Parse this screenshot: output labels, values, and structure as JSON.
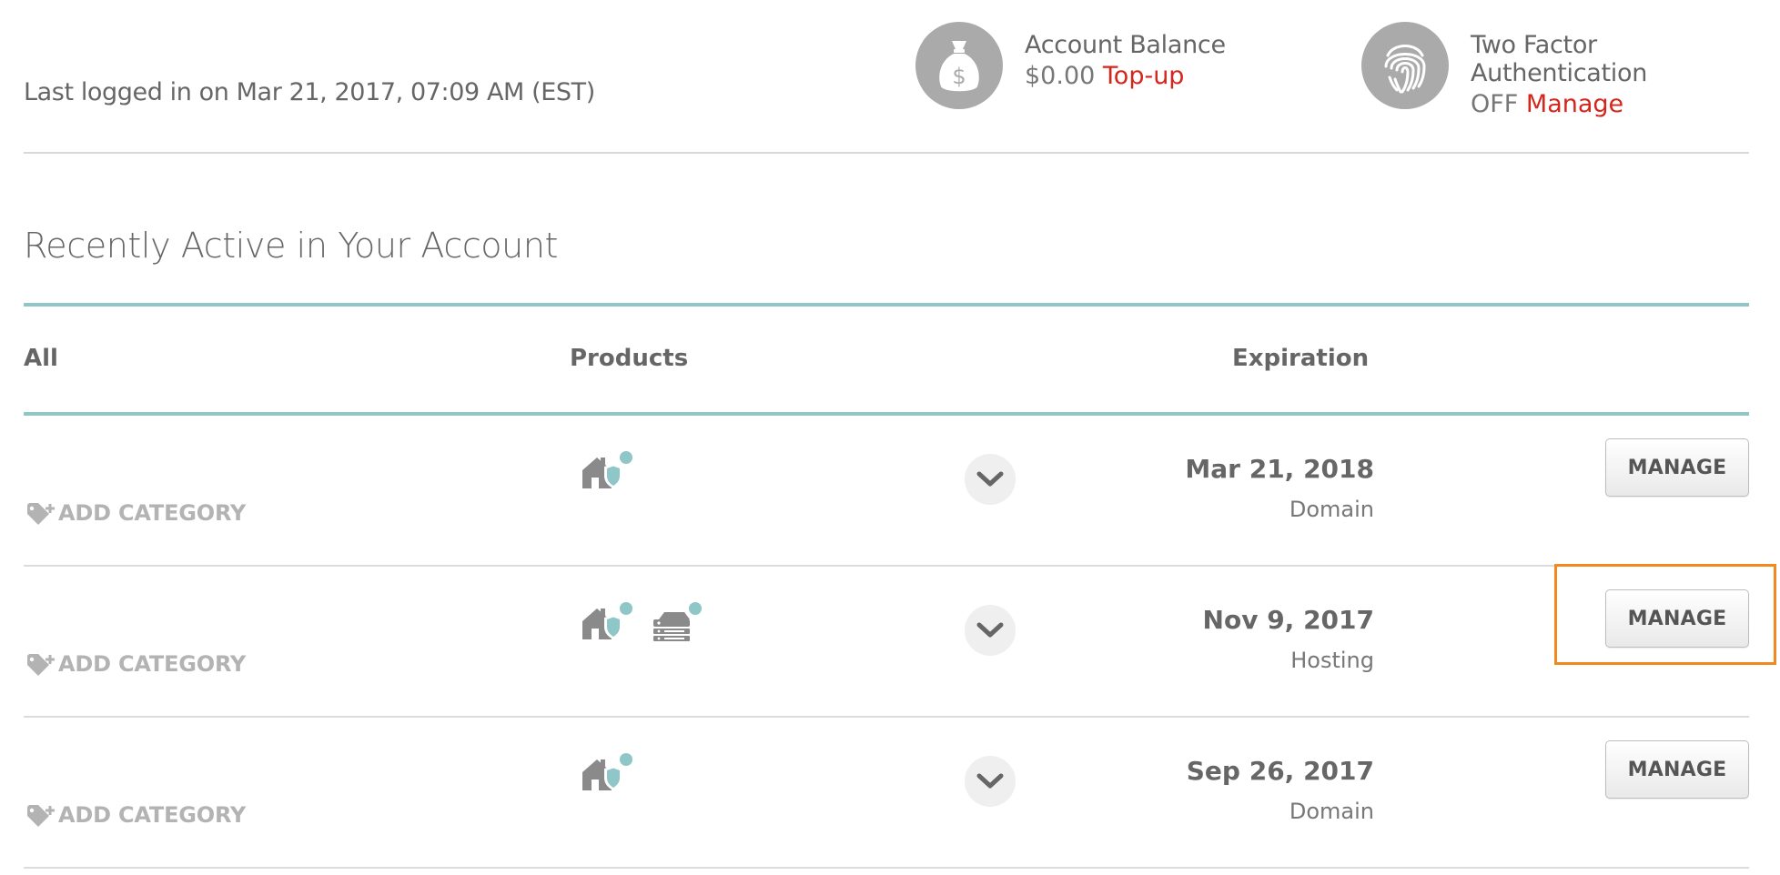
{
  "header": {
    "last_login": "Last logged in on Mar 21, 2017, 07:09 AM (EST)",
    "balance": {
      "icon": "money-bag-icon",
      "title": "Account Balance",
      "value": "$0.00",
      "link": "Top-up"
    },
    "two_factor": {
      "icon": "fingerprint-icon",
      "title_line1": "Two Factor",
      "title_line2": "Authentication",
      "status": "OFF",
      "link": "Manage"
    }
  },
  "section": {
    "title": "Recently Active in Your Account",
    "columns": {
      "all": "All",
      "products": "Products",
      "expiration": "Expiration"
    }
  },
  "rows": [
    {
      "add_category": "ADD CATEGORY",
      "products": [
        "domain-icon"
      ],
      "date": "Mar 21, 2018",
      "type": "Domain",
      "manage": "MANAGE"
    },
    {
      "add_category": "ADD CATEGORY",
      "products": [
        "domain-icon",
        "hosting-server-icon"
      ],
      "date": "Nov 9, 2017",
      "type": "Hosting",
      "manage": "MANAGE",
      "highlighted": true
    },
    {
      "add_category": "ADD CATEGORY",
      "products": [
        "domain-icon"
      ],
      "date": "Sep 26, 2017",
      "type": "Domain",
      "manage": "MANAGE"
    }
  ],
  "colors": {
    "accent_red": "#d4261c",
    "teal": "#8fc6c8",
    "highlight_orange": "#f0891e"
  }
}
